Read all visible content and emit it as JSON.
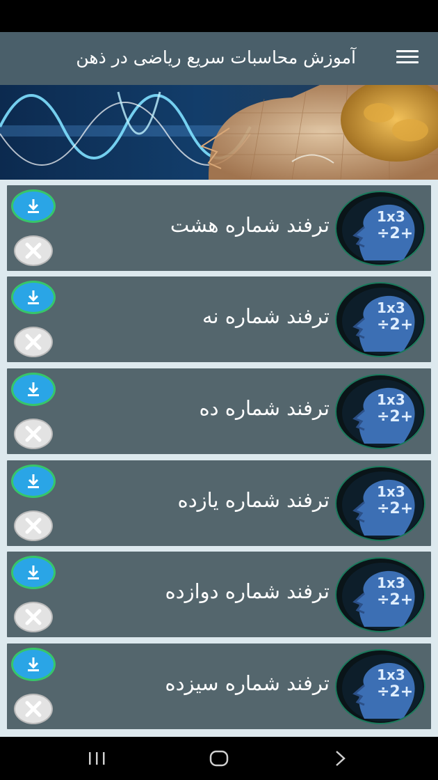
{
  "app_bar": {
    "title": "آموزش محاسبات سریع ریاضی در ذهن"
  },
  "rows": [
    {
      "label": "ترفند شماره هشت"
    },
    {
      "label": "ترفند شماره نه"
    },
    {
      "label": "ترفند شماره ده"
    },
    {
      "label": "ترفند شماره یازده"
    },
    {
      "label": "ترفند شماره دوازده"
    },
    {
      "label": "ترفند شماره سیزده"
    }
  ],
  "icons": {
    "menu": "hamburger-menu-icon",
    "download": "download-icon",
    "close": "close-icon",
    "thumbnail": "math-head-icon",
    "nav_recent": "recent-apps-icon",
    "nav_home": "home-icon",
    "nav_back": "back-icon"
  },
  "colors": {
    "app_bar": "#4a5f6a",
    "row_bg": "#54666d",
    "list_bg": "#dde9ee",
    "download": "#2aa5e6",
    "download_ring": "#37c66a"
  }
}
